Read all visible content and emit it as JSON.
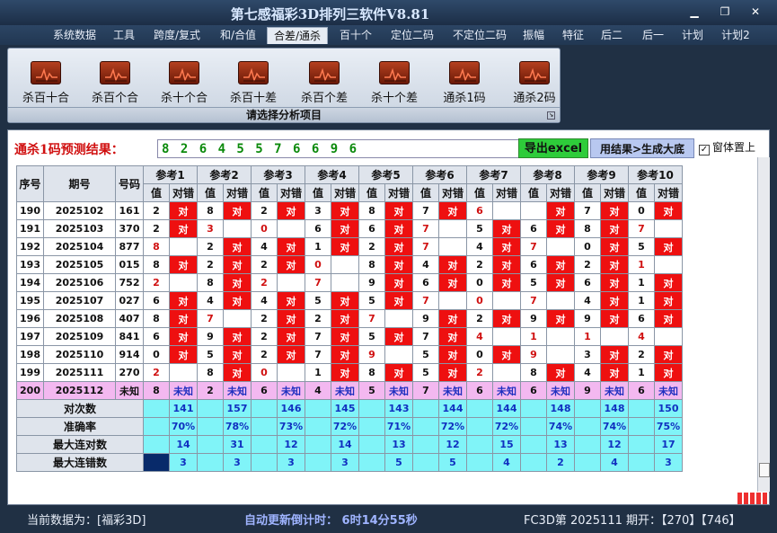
{
  "window": {
    "title": "第七感福彩3D排列三软件V8.81"
  },
  "menu": [
    "系统数据",
    "工具",
    "跨度/复式",
    "和/合值",
    "合差/通杀",
    "百十个",
    "定位二码",
    "不定位二码",
    "振幅",
    "特征",
    "后二",
    "后一",
    "计划",
    "计划2"
  ],
  "menu_active": "合差/通杀",
  "ribbon": {
    "buttons": [
      "杀百十合",
      "杀百个合",
      "杀十个合",
      "杀百十差",
      "杀百个差",
      "杀十个差",
      "通杀1码",
      "通杀2码"
    ],
    "footer": "请选择分析项目"
  },
  "prediction": {
    "label": "通杀1码预测结果：",
    "value": "8 2 6 4 5 5 7 6 6 9 6",
    "export_button": "导出excel",
    "generate_button": "用结果>生成大底",
    "ontop_label": "窗体置上",
    "ontop_checked": true
  },
  "table": {
    "headers": {
      "seq": "序号",
      "issue": "期号",
      "code": "号码"
    },
    "ref_groups": [
      "参考1",
      "参考2",
      "参考3",
      "参考4",
      "参考5",
      "参考6",
      "参考7",
      "参考8",
      "参考9",
      "参考10"
    ],
    "sub_headers": [
      "值",
      "对错"
    ],
    "hit_text": "对",
    "unknown_text": "未知",
    "rows": [
      {
        "seq": "190",
        "issue": "2025102",
        "code": "161",
        "vals": [
          "2",
          "8",
          "2",
          "3",
          "8",
          "7",
          "6",
          "",
          "7",
          "0"
        ],
        "hits": [
          1,
          1,
          1,
          1,
          1,
          1,
          0,
          1,
          1,
          1
        ],
        "red": [
          0,
          0,
          0,
          0,
          0,
          0,
          1,
          0,
          0,
          0
        ]
      },
      {
        "seq": "191",
        "issue": "2025103",
        "code": "370",
        "vals": [
          "2",
          "3",
          "0",
          "6",
          "6",
          "7",
          "5",
          "6",
          "8",
          "7"
        ],
        "hits": [
          1,
          0,
          0,
          1,
          1,
          0,
          1,
          1,
          1,
          0
        ],
        "red": [
          0,
          1,
          1,
          0,
          0,
          1,
          0,
          0,
          0,
          1
        ]
      },
      {
        "seq": "192",
        "issue": "2025104",
        "code": "877",
        "vals": [
          "8",
          "2",
          "4",
          "1",
          "2",
          "7",
          "4",
          "7",
          "0",
          "5"
        ],
        "hits": [
          0,
          1,
          1,
          1,
          1,
          0,
          1,
          0,
          1,
          1
        ],
        "red": [
          1,
          0,
          0,
          0,
          0,
          1,
          0,
          1,
          0,
          0
        ]
      },
      {
        "seq": "193",
        "issue": "2025105",
        "code": "015",
        "vals": [
          "8",
          "2",
          "2",
          "0",
          "8",
          "4",
          "2",
          "6",
          "2",
          "1"
        ],
        "hits": [
          1,
          1,
          1,
          0,
          1,
          1,
          1,
          1,
          1,
          0
        ],
        "red": [
          0,
          0,
          0,
          1,
          0,
          0,
          0,
          0,
          0,
          1
        ]
      },
      {
        "seq": "194",
        "issue": "2025106",
        "code": "752",
        "vals": [
          "2",
          "8",
          "2",
          "7",
          "9",
          "6",
          "0",
          "5",
          "6",
          "1"
        ],
        "hits": [
          0,
          1,
          0,
          0,
          1,
          1,
          1,
          1,
          1,
          1
        ],
        "red": [
          1,
          0,
          1,
          1,
          0,
          0,
          0,
          0,
          0,
          0
        ]
      },
      {
        "seq": "195",
        "issue": "2025107",
        "code": "027",
        "vals": [
          "6",
          "4",
          "4",
          "5",
          "5",
          "7",
          "0",
          "7",
          "4",
          "1"
        ],
        "hits": [
          1,
          1,
          1,
          1,
          1,
          0,
          0,
          0,
          1,
          1
        ],
        "red": [
          0,
          0,
          0,
          0,
          0,
          1,
          1,
          1,
          0,
          0
        ]
      },
      {
        "seq": "196",
        "issue": "2025108",
        "code": "407",
        "vals": [
          "8",
          "7",
          "2",
          "2",
          "7",
          "9",
          "2",
          "9",
          "9",
          "6"
        ],
        "hits": [
          1,
          0,
          1,
          1,
          0,
          1,
          1,
          1,
          1,
          1
        ],
        "red": [
          0,
          1,
          0,
          0,
          1,
          0,
          0,
          0,
          0,
          0
        ]
      },
      {
        "seq": "197",
        "issue": "2025109",
        "code": "841",
        "vals": [
          "6",
          "9",
          "2",
          "7",
          "5",
          "7",
          "4",
          "1",
          "1",
          "4"
        ],
        "hits": [
          1,
          1,
          1,
          1,
          1,
          1,
          0,
          0,
          0,
          0
        ],
        "red": [
          0,
          0,
          0,
          0,
          0,
          0,
          1,
          1,
          1,
          1
        ]
      },
      {
        "seq": "198",
        "issue": "2025110",
        "code": "914",
        "vals": [
          "0",
          "5",
          "2",
          "7",
          "9",
          "5",
          "0",
          "9",
          "3",
          "2"
        ],
        "hits": [
          1,
          1,
          1,
          1,
          0,
          1,
          1,
          0,
          1,
          1
        ],
        "red": [
          0,
          0,
          0,
          0,
          1,
          0,
          0,
          1,
          0,
          0
        ]
      },
      {
        "seq": "199",
        "issue": "2025111",
        "code": "270",
        "vals": [
          "2",
          "8",
          "0",
          "1",
          "8",
          "5",
          "2",
          "8",
          "4",
          "1"
        ],
        "hits": [
          0,
          1,
          0,
          1,
          1,
          1,
          0,
          1,
          1,
          1
        ],
        "red": [
          1,
          0,
          1,
          0,
          0,
          0,
          1,
          0,
          0,
          0
        ]
      }
    ],
    "unknown_row": {
      "seq": "200",
      "issue": "2025112",
      "code": "未知",
      "vals": [
        "8",
        "2",
        "6",
        "4",
        "5",
        "7",
        "6",
        "6",
        "9",
        "6"
      ]
    },
    "stats": [
      {
        "label": "对次数",
        "vals": [
          "141",
          "157",
          "146",
          "145",
          "143",
          "144",
          "144",
          "148",
          "148",
          "150"
        ]
      },
      {
        "label": "准确率",
        "vals": [
          "70%",
          "78%",
          "73%",
          "72%",
          "71%",
          "72%",
          "72%",
          "74%",
          "74%",
          "75%"
        ]
      },
      {
        "label": "最大连对数",
        "vals": [
          "14",
          "31",
          "12",
          "14",
          "13",
          "12",
          "15",
          "13",
          "12",
          "17"
        ]
      },
      {
        "label": "最大连错数",
        "vals": [
          "3",
          "3",
          "3",
          "3",
          "5",
          "5",
          "4",
          "2",
          "4",
          "3"
        ]
      }
    ]
  },
  "status": {
    "current_data": "当前数据为：[福彩3D]",
    "countdown": "自动更新倒计时：  6时14分55秒",
    "draw_info": "FC3D第 2025111 期开：【270】【746】"
  },
  "colors": {
    "hit": "#ee1010",
    "unknown_row": "#f3b8f0",
    "stats": "#80f4f8",
    "accent_green": "#2ecc3a"
  }
}
